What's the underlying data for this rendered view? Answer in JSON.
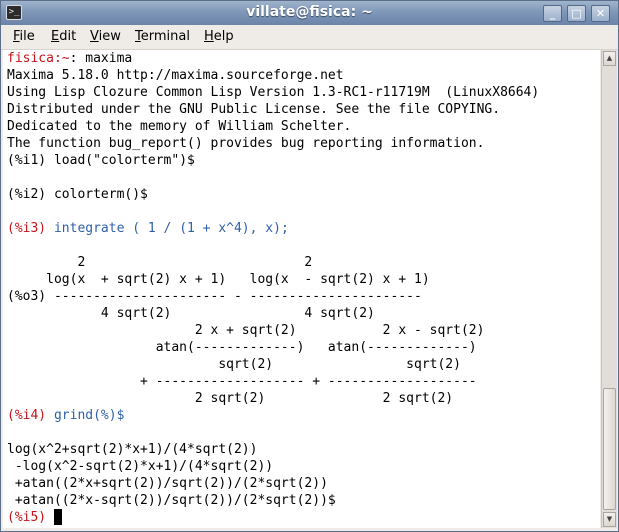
{
  "window": {
    "title": "villate@fisica: ~",
    "app_icon_glyph": ">_",
    "buttons": {
      "minimize": "_",
      "maximize": "□",
      "close": "✕"
    }
  },
  "menu": {
    "items": [
      {
        "label": "File",
        "mnemonic": "F",
        "rest": "ile"
      },
      {
        "label": "Edit",
        "mnemonic": "E",
        "rest": "dit"
      },
      {
        "label": "View",
        "mnemonic": "V",
        "rest": "iew"
      },
      {
        "label": "Terminal",
        "mnemonic": "T",
        "rest": "erminal"
      },
      {
        "label": "Help",
        "mnemonic": "H",
        "rest": "elp"
      }
    ]
  },
  "terminal": {
    "colors": {
      "background": "#ffffff",
      "text": "#000000",
      "prompt_red": "#c4141a",
      "input_blue": "#2f5fa8"
    },
    "shell_prompt": {
      "host": "fisica",
      "sep": ":~",
      "dollar": ": maxima"
    },
    "banner": [
      "Maxima 5.18.0 http://maxima.sourceforge.net",
      "Using Lisp Clozure Common Lisp Version 1.3-RC1-r11719M  (LinuxX8664)",
      "Distributed under the GNU Public License. See the file COPYING.",
      "Dedicated to the memory of William Schelter.",
      "The function bug_report() provides bug reporting information."
    ],
    "i1": {
      "label": "(%i1)",
      "input": " load(\"colorterm\")$"
    },
    "i2": {
      "label": "(%i2)",
      "input": " colorterm()$"
    },
    "i3": {
      "label": "(%i3)",
      "input": " integrate ( 1 / (1 + x^4), x);"
    },
    "o3_lines": [
      "         2                            2",
      "     log(x  + sqrt(2) x + 1)   log(x  - sqrt(2) x + 1)",
      "(%o3) ---------------------- - ----------------------",
      "            4 sqrt(2)                 4 sqrt(2)",
      "                        2 x + sqrt(2)           2 x - sqrt(2)",
      "                   atan(-------------)   atan(-------------)",
      "                           sqrt(2)                 sqrt(2)",
      "                 + ------------------- + -------------------",
      "                        2 sqrt(2)               2 sqrt(2)"
    ],
    "i4": {
      "label": "(%i4)",
      "input": " grind(%)$"
    },
    "grind_lines": [
      "log(x^2+sqrt(2)*x+1)/(4*sqrt(2))",
      " -log(x^2-sqrt(2)*x+1)/(4*sqrt(2))",
      " +atan((2*x+sqrt(2))/sqrt(2))/(2*sqrt(2))",
      " +atan((2*x-sqrt(2))/sqrt(2))/(2*sqrt(2))$"
    ],
    "i5": {
      "label": "(%i5)",
      "input": " "
    }
  },
  "scrollbar": {
    "up_glyph": "▲",
    "down_glyph": "▼"
  }
}
